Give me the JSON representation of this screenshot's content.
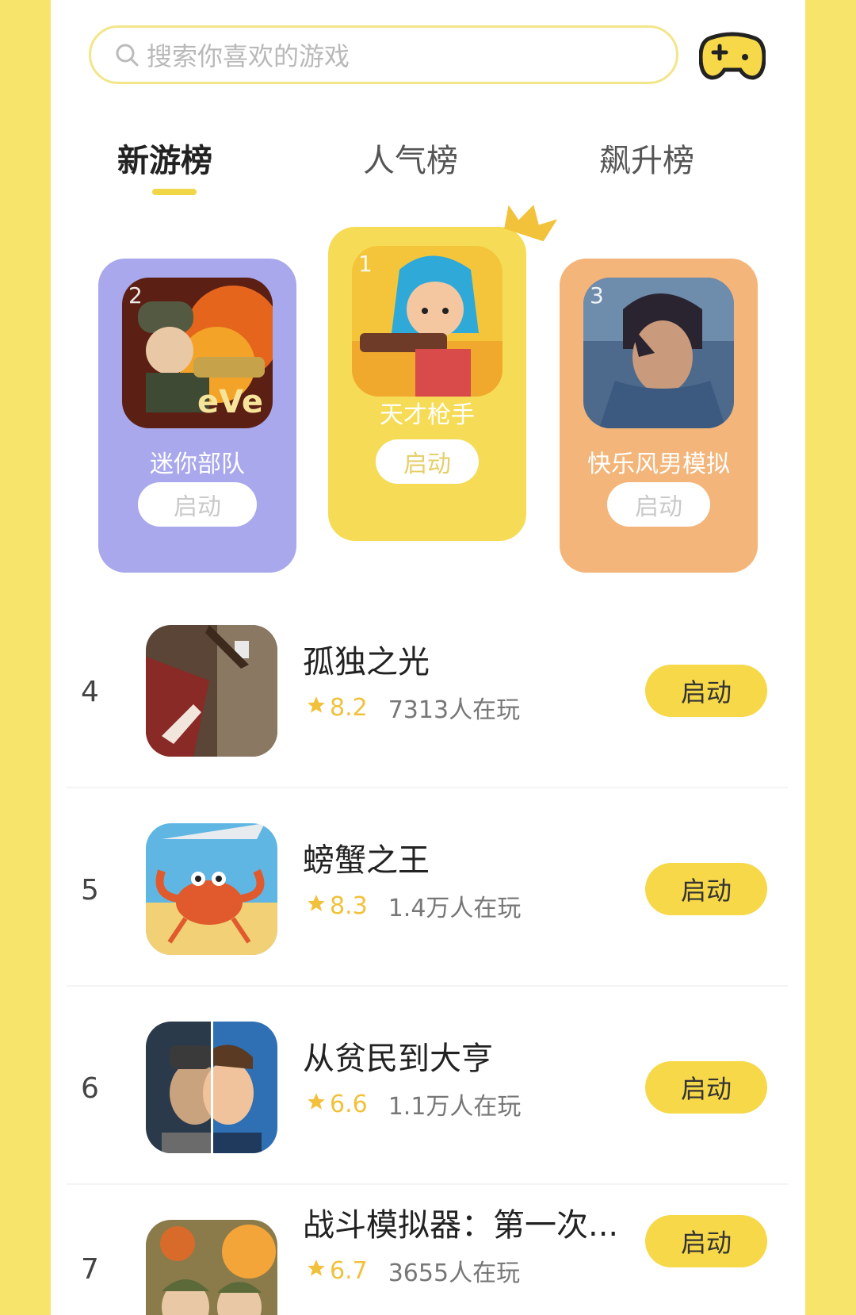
{
  "search": {
    "placeholder": "搜索你喜欢的游戏"
  },
  "tabs": [
    {
      "label": "新游榜",
      "active": true
    },
    {
      "label": "人气榜",
      "active": false
    },
    {
      "label": "飙升榜",
      "active": false
    }
  ],
  "podium": [
    {
      "rank": "2",
      "name": "迷你部队",
      "button": "启动",
      "icon": "soldier-game-icon"
    },
    {
      "rank": "1",
      "name": "天才枪手",
      "button": "启动",
      "icon": "gunner-girl-game-icon"
    },
    {
      "rank": "3",
      "name": "快乐风男模拟",
      "button": "启动",
      "icon": "swordsman-game-icon"
    }
  ],
  "list": [
    {
      "rank": "4",
      "title": "孤独之光",
      "score": "8.2",
      "players": "7313人在玩",
      "button": "启动"
    },
    {
      "rank": "5",
      "title": "螃蟹之王",
      "score": "8.3",
      "players": "1.4万人在玩",
      "button": "启动"
    },
    {
      "rank": "6",
      "title": "从贫民到大亨",
      "score": "6.6",
      "players": "1.1万人在玩",
      "button": "启动"
    },
    {
      "rank": "7",
      "title": "战斗模拟器：第一次...",
      "score": "6.7",
      "players": "3655人在玩",
      "button": "启动"
    }
  ],
  "colors": {
    "accent": "#f6d848",
    "background": "#f6e56a",
    "purple_card": "#a9a8ec",
    "yellow_card": "#f6dc56",
    "orange_card": "#f3b57a",
    "star": "#f1c13b"
  }
}
